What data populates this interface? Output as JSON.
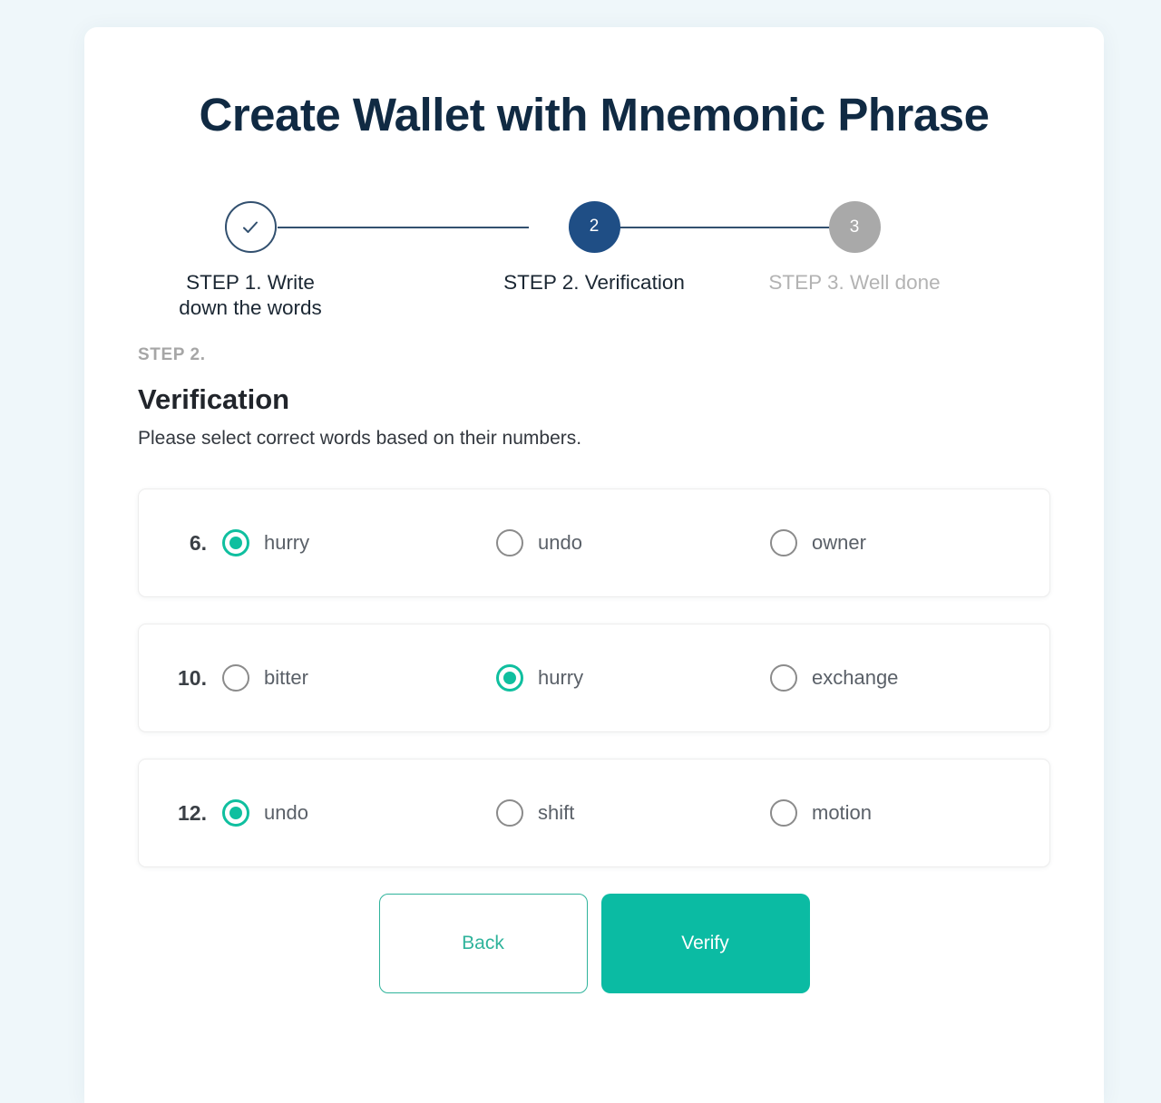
{
  "colors": {
    "page_background": "#eff7fa",
    "card_background": "#ffffff",
    "title": "#102a43",
    "step_active": "#1f4e85",
    "step_done_border": "#32506f",
    "step_todo": "#a9a9a9",
    "accent_teal": "#0bbba3",
    "radio_selected": "#0fbf9f",
    "radio_unselected": "#8b8b8b",
    "muted_text": "#a6a6a6"
  },
  "header": {
    "title": "Create Wallet with Mnemonic Phrase"
  },
  "stepper": {
    "steps": [
      {
        "id": "step-1",
        "marker": "check-icon",
        "label": "STEP 1. Write down the words",
        "state": "done"
      },
      {
        "id": "step-2",
        "marker": "2",
        "label": "STEP 2. Verification",
        "state": "active"
      },
      {
        "id": "step-3",
        "marker": "3",
        "label": "STEP 3. Well done",
        "state": "todo"
      }
    ]
  },
  "section": {
    "kicker": "STEP 2.",
    "title": "Verification",
    "subtitle": "Please select correct words based on their numbers."
  },
  "verification": {
    "rows": [
      {
        "number": "6.",
        "options": [
          {
            "label": "hurry",
            "selected": true
          },
          {
            "label": "undo",
            "selected": false
          },
          {
            "label": "owner",
            "selected": false
          }
        ]
      },
      {
        "number": "10.",
        "options": [
          {
            "label": "bitter",
            "selected": false
          },
          {
            "label": "hurry",
            "selected": true
          },
          {
            "label": "exchange",
            "selected": false
          }
        ]
      },
      {
        "number": "12.",
        "options": [
          {
            "label": "undo",
            "selected": true
          },
          {
            "label": "shift",
            "selected": false
          },
          {
            "label": "motion",
            "selected": false
          }
        ]
      }
    ]
  },
  "actions": {
    "back_label": "Back",
    "verify_label": "Verify"
  }
}
